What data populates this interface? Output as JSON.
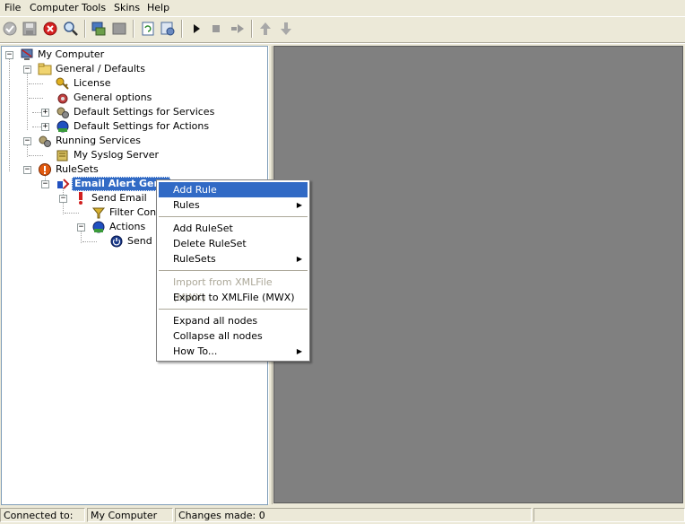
{
  "menu": [
    "File",
    "Computer",
    "Tools",
    "Skins",
    "Help"
  ],
  "toolbar": {
    "icons": [
      "check-icon",
      "save-icon",
      "delete-icon",
      "find-icon",
      "computer-settings-icon",
      "stop-service-icon",
      "refresh-icon",
      "configure-icon",
      "play-icon",
      "stop-icon",
      "step-icon",
      "move-up-icon",
      "move-down-icon"
    ]
  },
  "tree": {
    "root": "My Computer",
    "general": "General / Defaults",
    "license": "License",
    "general_options": "General options",
    "default_services": "Default Settings for Services",
    "default_actions": "Default Settings for Actions",
    "running_services": "Running Services",
    "syslog_server": "My Syslog Server",
    "rulesets": "RuleSets",
    "email_alert": "Email Alert Gene",
    "send_email": "Send Email",
    "filter_cond": "Filter Cond",
    "actions": "Actions",
    "send_e": "Send E"
  },
  "context_menu": {
    "add_rule": "Add Rule",
    "rules": "Rules",
    "add_ruleset": "Add RuleSet",
    "delete_ruleset": "Delete RuleSet",
    "rulesets": "RuleSets",
    "import_xml": "Import from XMLFile (MWX)",
    "export_xml": "Export to XMLFile (MWX)",
    "expand_all": "Expand all nodes",
    "collapse_all": "Collapse all nodes",
    "how_to": "How To..."
  },
  "status": {
    "connected_label": "Connected to:",
    "computer": "My Computer",
    "changes": "Changes made: 0"
  },
  "colors": {
    "selection": "#316ac5",
    "right_panel": "#808080",
    "chrome": "#ece9d8"
  }
}
